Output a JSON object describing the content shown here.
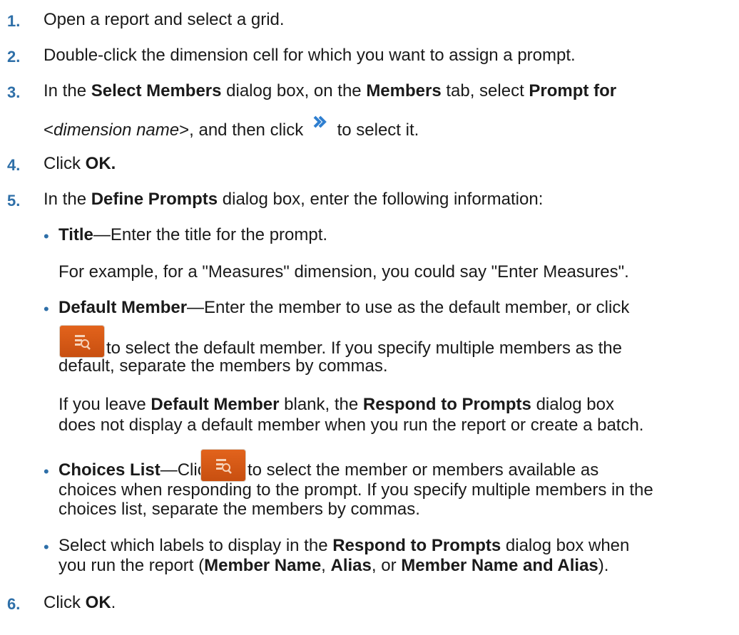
{
  "steps": [
    {
      "number": "1.",
      "text": "Open a report and select a grid."
    },
    {
      "number": "2.",
      "text": "Double-click the dimension cell for which you want to assign a prompt."
    },
    {
      "number": "3.",
      "parts": [
        "In the ",
        "Select Members",
        " dialog box, on the ",
        "Members",
        " tab, select ",
        "Prompt for"
      ],
      "line2": [
        "<",
        "dimension name",
        ">, and then click ",
        " to select it."
      ]
    },
    {
      "number": "4.",
      "parts": [
        "Click ",
        "OK."
      ]
    },
    {
      "number": "5.",
      "parts": [
        "In the ",
        "Define Prompts",
        " dialog box, enter the following information:"
      ]
    },
    {
      "number": "6.",
      "parts": [
        "Click ",
        "OK",
        "."
      ]
    }
  ],
  "bullets": {
    "title": {
      "term": "Title",
      "desc": "—Enter the title for the prompt.",
      "example": "For example, for a \"Measures\" dimension, you could say \"Enter Measures\"."
    },
    "default_member": {
      "term": "Default Member",
      "desc": "—Enter the member to use as the default member, or click",
      "after_icon": " to select the default member. If you specify multiple members as the",
      "line3": "default, separate the members by commas.",
      "note_parts": [
        "If you leave ",
        "Default Member",
        " blank, the ",
        "Respond to Prompts",
        " dialog box"
      ],
      "note_line2": "does not display a default member when you run the report or create a batch."
    },
    "choices_list": {
      "term": "Choices List",
      "desc": "—Click ",
      "after_icon": " to select the member or members available as",
      "line2": "choices when responding to the prompt. If you specify multiple members in the",
      "line3": "choices list, separate the members by commas."
    },
    "labels": {
      "parts": [
        "Select which labels to display in the ",
        "Respond to Prompts",
        " dialog box when"
      ],
      "line2": [
        "you run the report (",
        "Member Name",
        ", ",
        "Alias",
        ", or ",
        "Member Name and Alias",
        ")."
      ]
    }
  },
  "icons": {
    "select_arrow": "double-chevron-right-icon",
    "member_selector": "member-selector-icon",
    "accent_color": "#2e6fa8",
    "button_color": "#d4561a"
  }
}
